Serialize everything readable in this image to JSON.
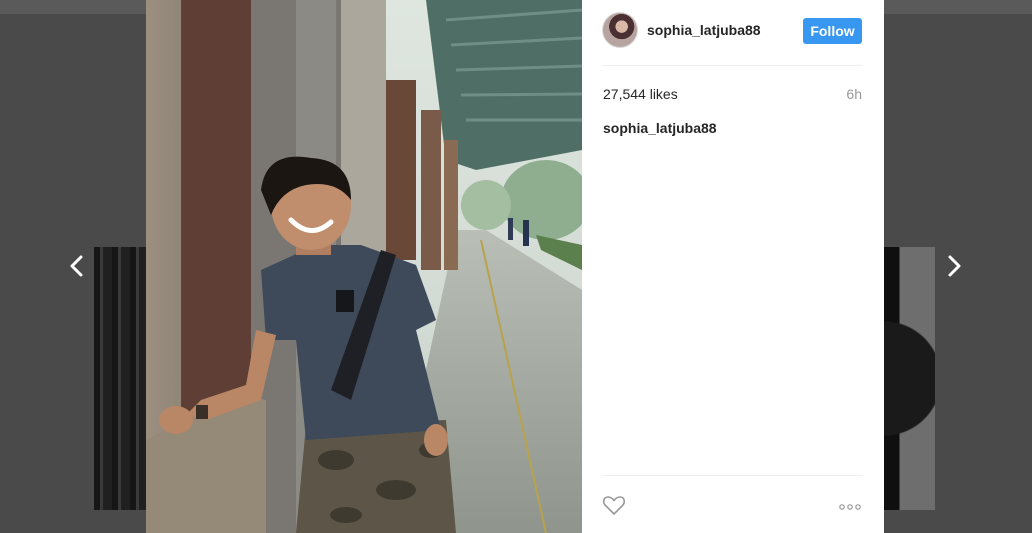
{
  "post": {
    "author": {
      "username": "sophia_latjuba88",
      "avatar_icon": "profile-avatar"
    },
    "follow_label": "Follow",
    "likes_text": "27,544 likes",
    "time_ago": "6h",
    "caption_username": "sophia_latjuba88"
  },
  "navigation": {
    "prev_icon": "chevron-left-icon",
    "next_icon": "chevron-right-icon"
  },
  "actions": {
    "like_icon": "heart-outline-icon",
    "more_icon": "more-options-icon"
  },
  "colors": {
    "overlay": "#4a4a4a",
    "panel_bg": "#ffffff",
    "follow_button": "#3897f0",
    "muted_text": "#999999",
    "primary_text": "#262626"
  }
}
